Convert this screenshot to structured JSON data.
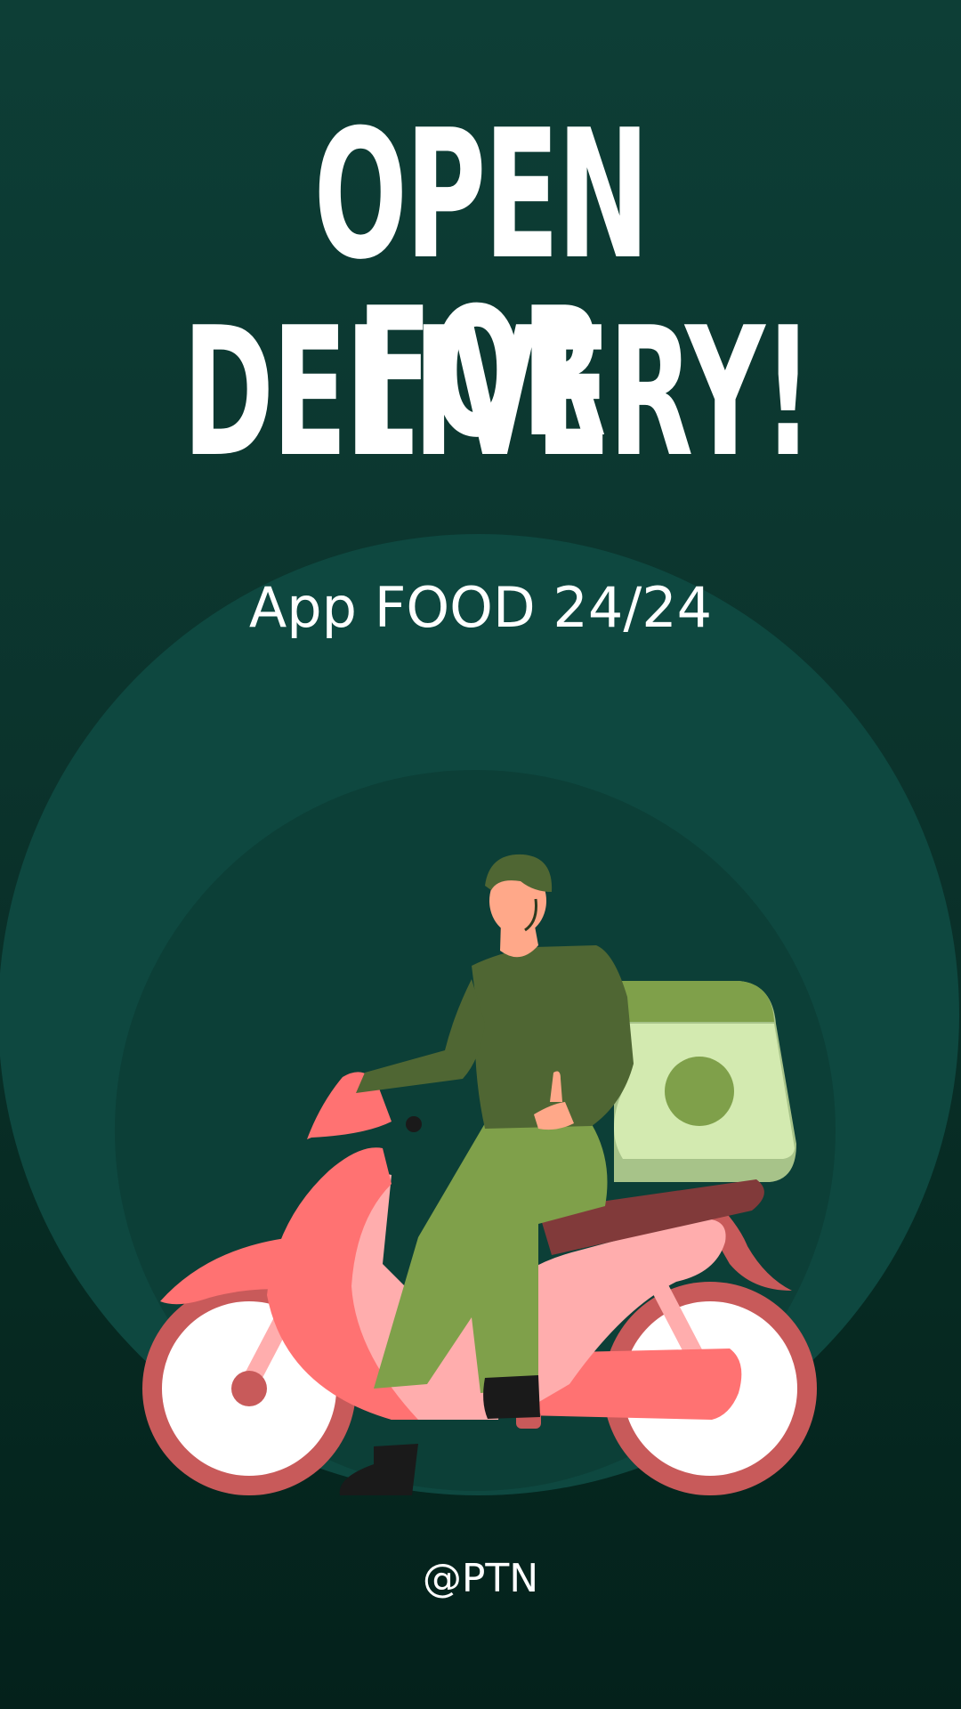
{
  "poster": {
    "headline_line1": "OPEN FOR",
    "headline_line2": "DELIVERY!",
    "subtitle": "App FOOD 24/24",
    "handle": "@PTN"
  },
  "colors": {
    "background": "#0b332c",
    "circle": "#0e4840",
    "text": "#ffffff",
    "scooter": "#ff7272",
    "rider_shirt": "#4f6633",
    "rider_pants": "#7fa04a",
    "delivery_box": "#d3eab0"
  },
  "illustration": "delivery-rider-on-scooter"
}
